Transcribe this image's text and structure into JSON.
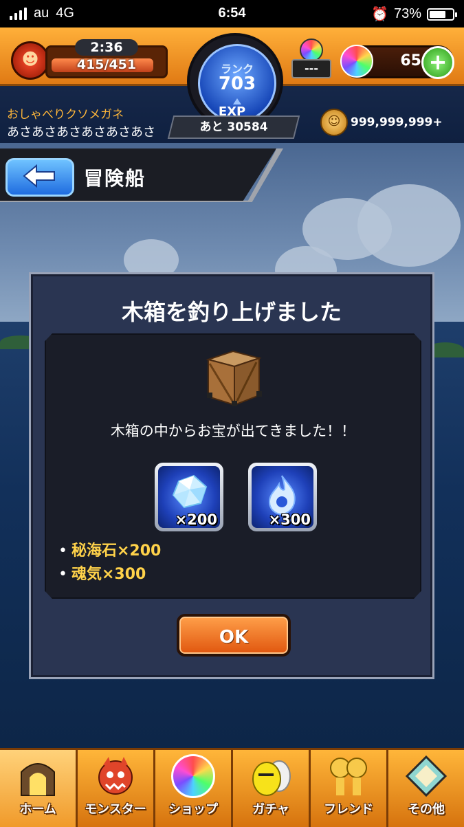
{
  "status_bar": {
    "carrier": "au",
    "network": "4G",
    "time": "6:54",
    "battery": "73%",
    "battery_level": 0.73
  },
  "header": {
    "stamina_timer": "2:36",
    "stamina": "415/451",
    "stamina_level": 0.92,
    "rank_label": "ランク",
    "rank": "703",
    "exp_label": "EXP",
    "exp_remaining": "あと 30584",
    "orb_slot_value": "---",
    "orbs": "65",
    "player_title": "おしゃべりクソメガネ",
    "player_name": "あさあさあさあさあさあさ",
    "gold": "999,999,999+"
  },
  "page": {
    "title": "冒険船"
  },
  "dialog": {
    "title": "木箱を釣り上げました",
    "message": "木箱の中からお宝が出てきました！！",
    "rewards": [
      {
        "icon": "crystal-icon",
        "qty": "×200"
      },
      {
        "icon": "soul-flame-icon",
        "qty": "×300"
      }
    ],
    "lines": [
      "秘海石×200",
      "魂気×300"
    ],
    "ok_label": "OK"
  },
  "nav": [
    {
      "label": "ホーム",
      "icon": "home-gate-icon",
      "active": true
    },
    {
      "label": "モンスター",
      "icon": "monster-icon"
    },
    {
      "label": "ショップ",
      "icon": "orb-icon"
    },
    {
      "label": "ガチャ",
      "icon": "gacha-egg-icon"
    },
    {
      "label": "フレンド",
      "icon": "friends-balloon-icon"
    },
    {
      "label": "その他",
      "icon": "other-icon"
    }
  ]
}
